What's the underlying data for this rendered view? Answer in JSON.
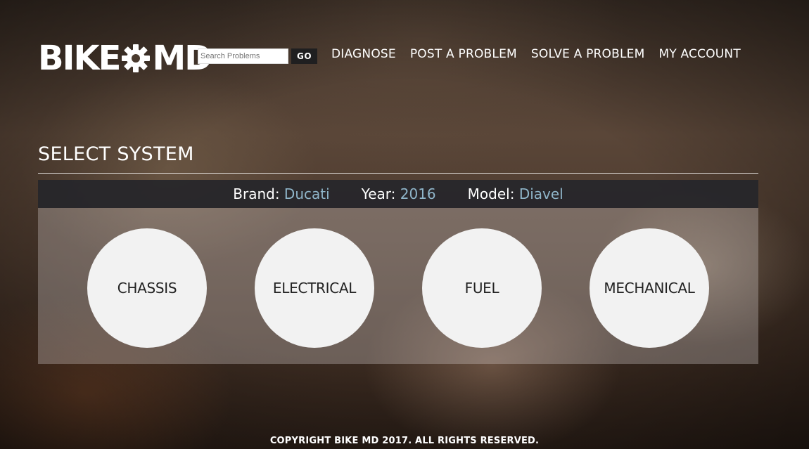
{
  "brand": {
    "logo_left": "BIKE",
    "logo_right": "MD"
  },
  "search": {
    "placeholder": "Search Problems",
    "button_label": "GO"
  },
  "nav": {
    "items": [
      {
        "label": "DIAGNOSE"
      },
      {
        "label": "POST A PROBLEM"
      },
      {
        "label": "SOLVE A PROBLEM"
      },
      {
        "label": "MY ACCOUNT"
      }
    ]
  },
  "main": {
    "title": "SELECT SYSTEM",
    "vehicle": {
      "brand_label": "Brand:",
      "brand_value": "Ducati",
      "year_label": "Year:",
      "year_value": "2016",
      "model_label": "Model:",
      "model_value": "Diavel"
    },
    "systems": [
      {
        "label": "CHASSIS"
      },
      {
        "label": "ELECTRICAL"
      },
      {
        "label": "FUEL"
      },
      {
        "label": "MECHANICAL"
      }
    ]
  },
  "footer": {
    "copyright": "COPYRIGHT BIKE MD 2017. ALL RIGHTS RESERVED."
  },
  "colors": {
    "accent_value": "#8fb5c9",
    "info_bar_bg": "#26262a",
    "circle_bg": "#f2f2f2"
  },
  "icons": {
    "logo_gear": "gear-icon"
  }
}
